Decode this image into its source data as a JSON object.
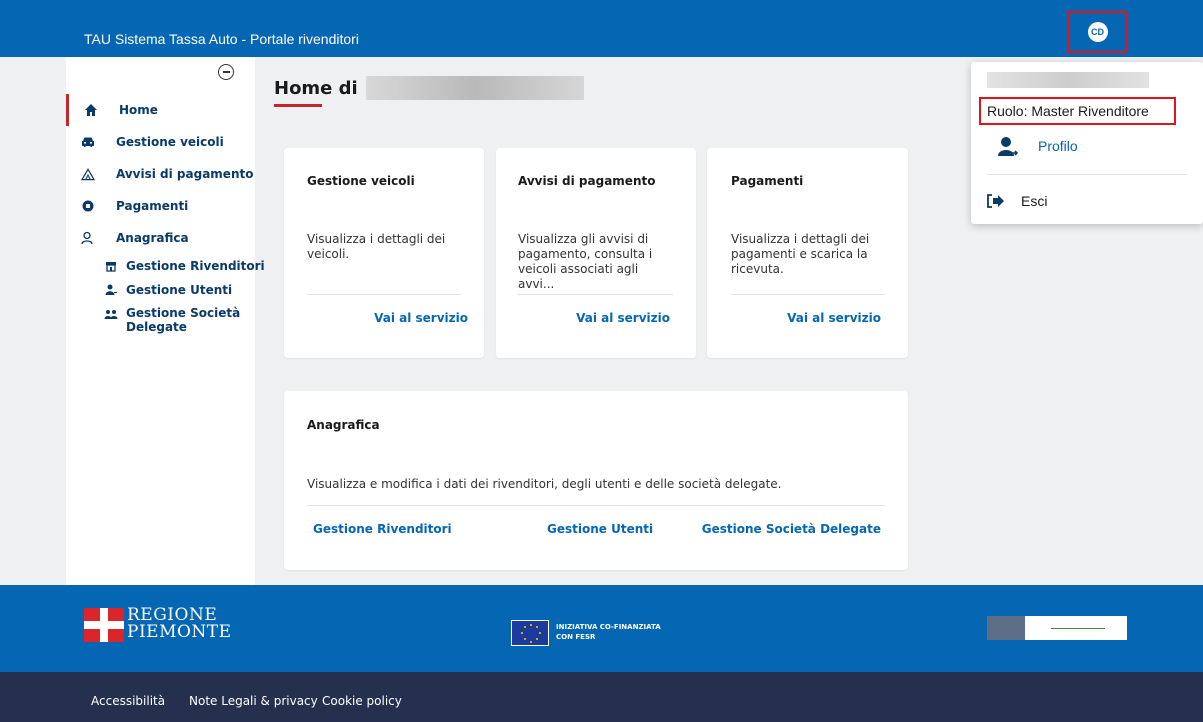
{
  "header": {
    "app_title": "TAU Sistema Tassa Auto - Portale rivenditori",
    "avatar_initials": "CD"
  },
  "sidebar": {
    "items": [
      {
        "label": "Home",
        "icon": "home-icon",
        "active": true
      },
      {
        "label": "Gestione veicoli",
        "icon": "car-icon"
      },
      {
        "label": "Avvisi di pagamento",
        "icon": "warning-icon"
      },
      {
        "label": "Pagamenti",
        "icon": "payment-icon"
      },
      {
        "label": "Anagrafica",
        "icon": "person-icon"
      }
    ],
    "subitems": [
      {
        "label": "Gestione Rivenditori",
        "icon": "store-icon"
      },
      {
        "label": "Gestione Utenti",
        "icon": "user-add-icon"
      },
      {
        "label": "Gestione Società Delegate",
        "icon": "group-icon"
      }
    ]
  },
  "main": {
    "title": "Home di",
    "cards": [
      {
        "title": "Gestione veicoli",
        "desc": "Visualizza i dettagli dei veicoli.",
        "link": "Vai al servizio"
      },
      {
        "title": "Avvisi di pagamento",
        "desc": "Visualizza gli avvisi di pagamento, consulta i veicoli associati agli avvi...",
        "link": "Vai al servizio"
      },
      {
        "title": "Pagamenti",
        "desc": "Visualizza i dettagli dei pagamenti e scarica la ricevuta.",
        "link": "Vai al servizio"
      }
    ],
    "anagrafica": {
      "title": "Anagrafica",
      "desc": "Visualizza e modifica i dati dei rivenditori, degli utenti e delle società delegate.",
      "links": [
        "Gestione Rivenditori",
        "Gestione Utenti",
        "Gestione Società Delegate"
      ]
    }
  },
  "dropdown": {
    "role": "Ruolo: Master Rivenditore",
    "profile": "Profilo",
    "logout": "Esci"
  },
  "footer": {
    "region_line1": "REGIONE",
    "region_line2": "PIEMONTE",
    "eu_line1": "INIZIATIVA CO-FINANZIATA",
    "eu_line2": "CON FESR",
    "links": [
      "Accessibilità",
      "Note Legali & privacy",
      "Cookie policy"
    ]
  },
  "colors": {
    "primary": "#0566b3",
    "accent_red": "#c1272d",
    "highlight": "#e4121a",
    "footer_dark": "#24304d"
  }
}
